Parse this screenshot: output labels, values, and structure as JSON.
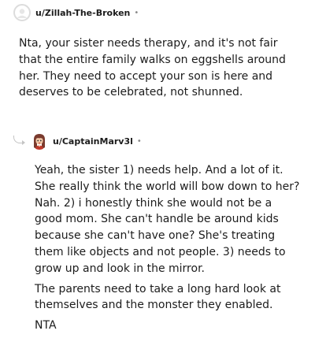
{
  "comments": [
    {
      "username": "u/Zillah-The-Broken",
      "separator": "•",
      "avatar_icon": "default-user-avatar",
      "paragraphs": [
        "Nta, your sister needs therapy, and it's not fair that the entire family walks on eggshells around her. They need to accept your son is here and deserves to be celebrated, not shunned."
      ]
    },
    {
      "username": "u/CaptainMarv3l",
      "separator": "•",
      "avatar_icon": "brown-hair-character-avatar",
      "paragraphs": [
        "Yeah, the sister 1) needs help. And a lot of it. She really think the world will bow down to her? Nah. 2) i honestly think she would not be a good mom. She can't handle be around kids because she can't have one? She's treating them like objects and not people. 3) needs to grow up and look in the mirror.",
        "The parents need to take a long hard look at themselves and the monster they enabled.",
        "NTA"
      ]
    }
  ]
}
